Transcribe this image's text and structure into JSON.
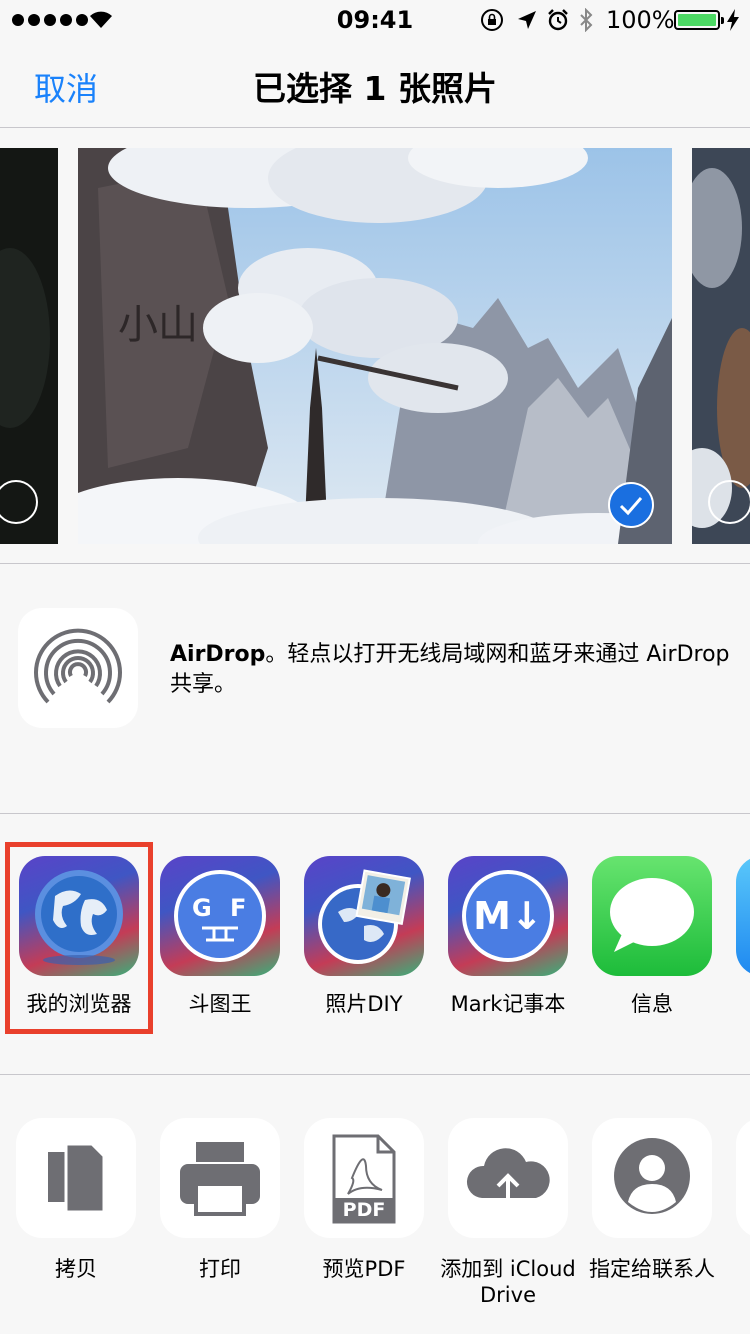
{
  "status_bar": {
    "time": "09:41",
    "battery": "100%",
    "icons": [
      "signal-dots",
      "wifi-icon",
      "rotation-lock-icon",
      "location-icon",
      "alarm-icon",
      "bluetooth-icon",
      "battery-icon",
      "charging-icon"
    ]
  },
  "nav": {
    "cancel": "取消",
    "title": "已选择 1 张照片"
  },
  "photos": [
    {
      "selected": false
    },
    {
      "selected": true
    },
    {
      "selected": false
    }
  ],
  "airdrop": {
    "name": "AirDrop",
    "message": "。轻点以打开无线局域网和蓝牙来通过 AirDrop 共享。"
  },
  "apps": [
    {
      "label": "我的浏览器",
      "icon": "globe-icon",
      "highlighted": true
    },
    {
      "label": "斗图王",
      "icon": "doutu-icon"
    },
    {
      "label": "照片DIY",
      "icon": "photo-diy-icon"
    },
    {
      "label": "Mark记事本",
      "icon": "markdown-icon",
      "glyph": "M↓"
    },
    {
      "label": "信息",
      "icon": "messages-icon"
    }
  ],
  "actions": [
    {
      "label": "拷贝",
      "icon": "copy-icon"
    },
    {
      "label": "打印",
      "icon": "print-icon"
    },
    {
      "label": "预览PDF",
      "icon": "pdf-icon",
      "glyph": "PDF"
    },
    {
      "label": "添加到 iCloud Drive",
      "icon": "icloud-upload-icon"
    },
    {
      "label": "指定给联系人",
      "icon": "contact-icon"
    }
  ],
  "colors": {
    "accent": "#1a82fb",
    "highlight_border": "#e9402c",
    "battery_fill": "#4cd964",
    "messages_green": "#4cd964"
  }
}
